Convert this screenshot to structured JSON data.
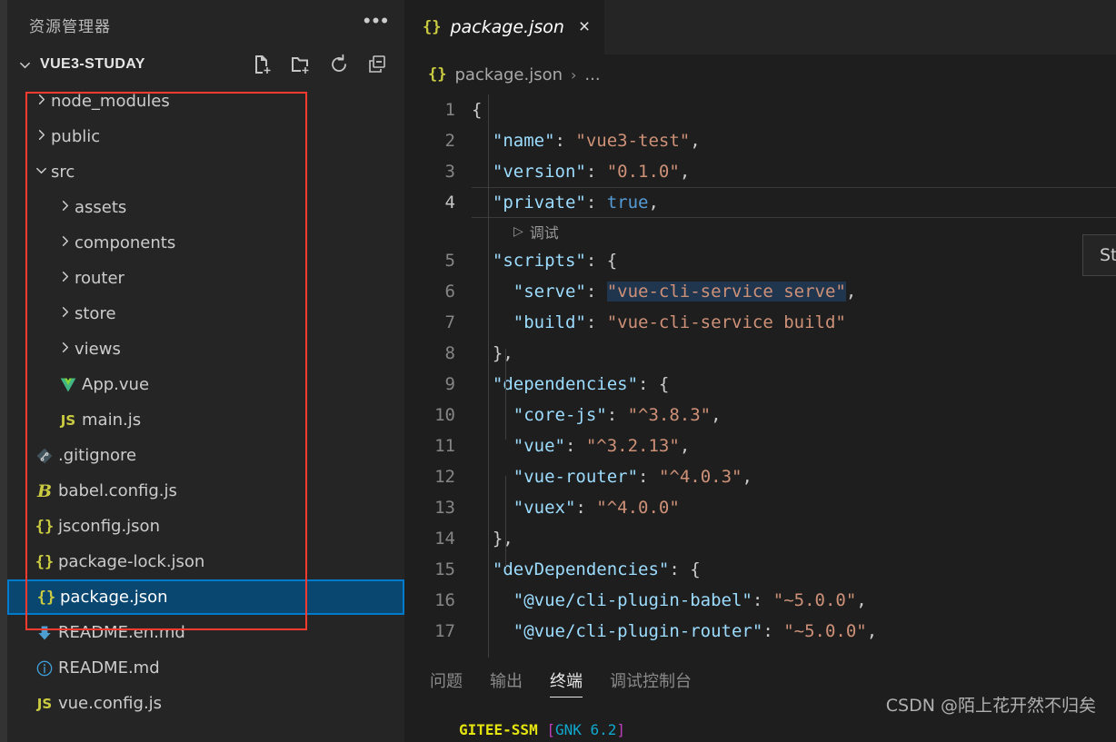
{
  "colors": {
    "editor_bg": "#1e1e1e",
    "sidebar_bg": "#252526",
    "activity_bg": "#333333",
    "selection_blue": "#094771",
    "focus_border": "#007acc",
    "annotation_red": "#ff3b30",
    "key_blue": "#9cdcfe",
    "string_orange": "#ce9178",
    "boolean_blue": "#569cd6"
  },
  "sidebar": {
    "title": "资源管理器",
    "more_actions": "•••",
    "folder": {
      "name": "VUE3-STUDAY",
      "chevron": "⌄",
      "actions": [
        {
          "name": "new-file-icon",
          "tip": "新建文件"
        },
        {
          "name": "new-folder-icon",
          "tip": "新建文件夹"
        },
        {
          "name": "refresh-icon",
          "tip": "刷新资源管理器"
        },
        {
          "name": "collapse-all-icon",
          "tip": "在资源管理器中折叠文件夹"
        }
      ]
    },
    "items": [
      {
        "label": "node_modules",
        "type": "folder",
        "expanded": false,
        "indent": 1,
        "icon": "chevron-right-icon"
      },
      {
        "label": "public",
        "type": "folder",
        "expanded": false,
        "indent": 1,
        "icon": "chevron-right-icon"
      },
      {
        "label": "src",
        "type": "folder",
        "expanded": true,
        "indent": 1,
        "icon": "chevron-down-icon"
      },
      {
        "label": "assets",
        "type": "folder",
        "expanded": false,
        "indent": 2,
        "icon": "chevron-right-icon"
      },
      {
        "label": "components",
        "type": "folder",
        "expanded": false,
        "indent": 2,
        "icon": "chevron-right-icon"
      },
      {
        "label": "router",
        "type": "folder",
        "expanded": false,
        "indent": 2,
        "icon": "chevron-right-icon"
      },
      {
        "label": "store",
        "type": "folder",
        "expanded": false,
        "indent": 2,
        "icon": "chevron-right-icon"
      },
      {
        "label": "views",
        "type": "folder",
        "expanded": false,
        "indent": 2,
        "icon": "chevron-right-icon"
      },
      {
        "label": "App.vue",
        "type": "file",
        "indent": 2,
        "icon": "vue-file-icon"
      },
      {
        "label": "main.js",
        "type": "file",
        "indent": 2,
        "icon": "js-file-icon"
      },
      {
        "label": ".gitignore",
        "type": "file",
        "indent": 1,
        "icon": "git-file-icon"
      },
      {
        "label": "babel.config.js",
        "type": "file",
        "indent": 1,
        "icon": "babel-file-icon"
      },
      {
        "label": "jsconfig.json",
        "type": "file",
        "indent": 1,
        "icon": "json-file-icon"
      },
      {
        "label": "package-lock.json",
        "type": "file",
        "indent": 1,
        "icon": "json-file-icon"
      },
      {
        "label": "package.json",
        "type": "file",
        "indent": 1,
        "icon": "json-file-icon",
        "selected": true
      },
      {
        "label": "README.en.md",
        "type": "file",
        "indent": 1,
        "icon": "markdown-down-icon"
      },
      {
        "label": "README.md",
        "type": "file",
        "indent": 1,
        "icon": "info-circle-icon"
      },
      {
        "label": "vue.config.js",
        "type": "file",
        "indent": 1,
        "icon": "js-file-icon"
      }
    ]
  },
  "editor": {
    "tab": {
      "label": "package.json",
      "icon": "json-file-icon",
      "close": "×",
      "dirty": false,
      "preview_italic": true
    },
    "breadcrumb": {
      "file": "package.json",
      "separator": "›",
      "tail": "..."
    },
    "codelens": {
      "play": "▷",
      "label": "调试"
    },
    "tooltip": "Start dev server to serve application files",
    "lines": [
      {
        "n": "1",
        "indent": 0,
        "tokens": [
          {
            "t": "{",
            "c": "p"
          }
        ]
      },
      {
        "n": "2",
        "indent": 1,
        "tokens": [
          {
            "t": "\"name\"",
            "c": "k"
          },
          {
            "t": ": ",
            "c": "p"
          },
          {
            "t": "\"vue3-test\"",
            "c": "s"
          },
          {
            "t": ",",
            "c": "p"
          }
        ]
      },
      {
        "n": "3",
        "indent": 1,
        "tokens": [
          {
            "t": "\"version\"",
            "c": "k"
          },
          {
            "t": ": ",
            "c": "p"
          },
          {
            "t": "\"0.1.0\"",
            "c": "s"
          },
          {
            "t": ",",
            "c": "p"
          }
        ]
      },
      {
        "n": "4",
        "indent": 1,
        "current": true,
        "tokens": [
          {
            "t": "\"private\"",
            "c": "k"
          },
          {
            "t": ": ",
            "c": "p"
          },
          {
            "t": "true",
            "c": "b"
          },
          {
            "t": ",",
            "c": "p"
          }
        ]
      },
      {
        "n": "5",
        "indent": 1,
        "tokens": [
          {
            "t": "\"scripts\"",
            "c": "k"
          },
          {
            "t": ": {",
            "c": "p"
          }
        ]
      },
      {
        "n": "6",
        "indent": 2,
        "tokens": [
          {
            "t": "\"serve\"",
            "c": "k"
          },
          {
            "t": ": ",
            "c": "p"
          },
          {
            "t": "\"vue-cli-service serve\"",
            "c": "s",
            "selected": true
          },
          {
            "t": ",",
            "c": "p"
          }
        ]
      },
      {
        "n": "7",
        "indent": 2,
        "tokens": [
          {
            "t": "\"build\"",
            "c": "k"
          },
          {
            "t": ": ",
            "c": "p"
          },
          {
            "t": "\"vue-cli-service build\"",
            "c": "s"
          }
        ]
      },
      {
        "n": "8",
        "indent": 1,
        "tokens": [
          {
            "t": "},",
            "c": "p"
          }
        ]
      },
      {
        "n": "9",
        "indent": 1,
        "tokens": [
          {
            "t": "\"dependencies\"",
            "c": "k"
          },
          {
            "t": ": {",
            "c": "p"
          }
        ]
      },
      {
        "n": "10",
        "indent": 2,
        "tokens": [
          {
            "t": "\"core-js\"",
            "c": "k"
          },
          {
            "t": ": ",
            "c": "p"
          },
          {
            "t": "\"^3.8.3\"",
            "c": "s"
          },
          {
            "t": ",",
            "c": "p"
          }
        ]
      },
      {
        "n": "11",
        "indent": 2,
        "tokens": [
          {
            "t": "\"vue\"",
            "c": "k"
          },
          {
            "t": ": ",
            "c": "p"
          },
          {
            "t": "\"^3.2.13\"",
            "c": "s"
          },
          {
            "t": ",",
            "c": "p"
          }
        ]
      },
      {
        "n": "12",
        "indent": 2,
        "tokens": [
          {
            "t": "\"vue-router\"",
            "c": "k"
          },
          {
            "t": ": ",
            "c": "p"
          },
          {
            "t": "\"^4.0.3\"",
            "c": "s"
          },
          {
            "t": ",",
            "c": "p"
          }
        ]
      },
      {
        "n": "13",
        "indent": 2,
        "tokens": [
          {
            "t": "\"vuex\"",
            "c": "k"
          },
          {
            "t": ": ",
            "c": "p"
          },
          {
            "t": "\"^4.0.0\"",
            "c": "s"
          }
        ]
      },
      {
        "n": "14",
        "indent": 1,
        "tokens": [
          {
            "t": "},",
            "c": "p"
          }
        ]
      },
      {
        "n": "15",
        "indent": 1,
        "tokens": [
          {
            "t": "\"devDependencies\"",
            "c": "k"
          },
          {
            "t": ": {",
            "c": "p"
          }
        ]
      },
      {
        "n": "16",
        "indent": 2,
        "tokens": [
          {
            "t": "\"@vue/cli-plugin-babel\"",
            "c": "k"
          },
          {
            "t": ": ",
            "c": "p"
          },
          {
            "t": "\"~5.0.0\"",
            "c": "s"
          },
          {
            "t": ",",
            "c": "p"
          }
        ]
      },
      {
        "n": "17",
        "indent": 2,
        "tokens": [
          {
            "t": "\"@vue/cli-plugin-router\"",
            "c": "k"
          },
          {
            "t": ": ",
            "c": "p"
          },
          {
            "t": "\"~5.0.0\"",
            "c": "s"
          },
          {
            "t": ",",
            "c": "p"
          }
        ]
      }
    ]
  },
  "panel": {
    "tabs": [
      {
        "label": "问题",
        "active": false
      },
      {
        "label": "输出",
        "active": false
      },
      {
        "label": "终端",
        "active": true
      },
      {
        "label": "调试控制台",
        "active": false
      }
    ],
    "terminal_line": [
      {
        "t": "GITEE-SSM",
        "c": "t-yellow"
      },
      {
        "t": " [",
        "c": "t-purple"
      },
      {
        "t": "GNK 6.2",
        "c": "t-cyan"
      },
      {
        "t": "]",
        "c": "t-purple"
      }
    ]
  },
  "watermark": "CSDN @陌上花开然不归矣"
}
